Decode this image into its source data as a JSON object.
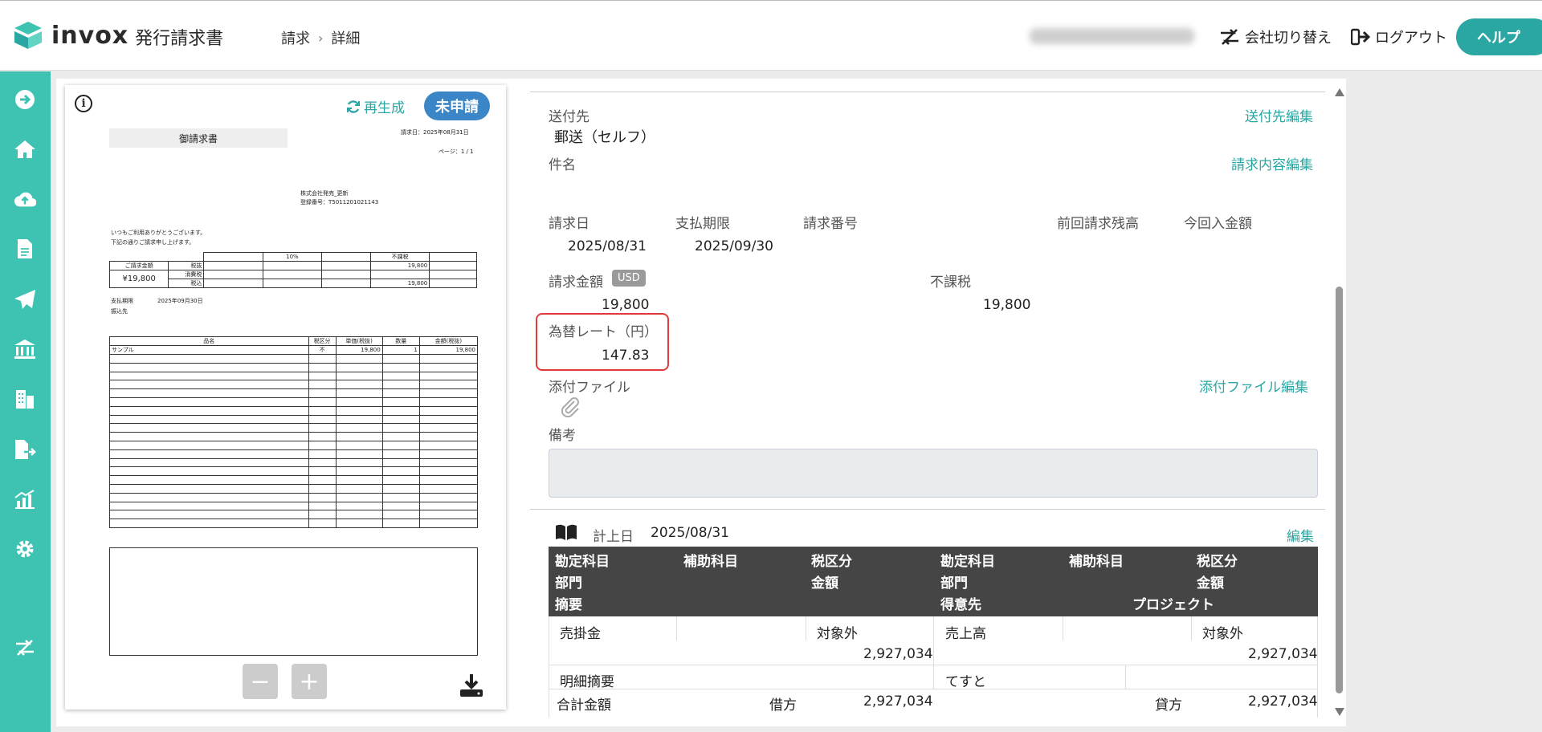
{
  "header": {
    "logo_word": "invox",
    "logo_sub": "発行請求書",
    "breadcrumb": [
      "請求",
      "詳細"
    ],
    "switch_company": "会社切り替え",
    "logout": "ログアウト",
    "help": "ヘルプ"
  },
  "sidebar": {
    "icons": [
      "arrow-right-icon",
      "home-icon",
      "cloud-upload-icon",
      "document-icon",
      "send-icon",
      "bank-icon",
      "building-icon",
      "file-export-icon",
      "chart-icon",
      "gear-icon",
      "switch-icon"
    ]
  },
  "preview": {
    "regen": "再生成",
    "status": "未申請",
    "doc": {
      "title": "御請求書",
      "date": "請求日：2025年08月31日",
      "page": "ページ：1 / 1",
      "company": "株式会社発売_更新",
      "reg_no": "登録番号：T5011201021143",
      "greeting1": "いつもご利用ありがとうございます。",
      "greeting2": "下記の通りご請求申し上げます。",
      "amount_label": "ご請求金額",
      "amount": "¥19,800",
      "rate10": "10%",
      "nontax": "不課税",
      "row_labels": [
        "税抜",
        "消費税",
        "税込"
      ],
      "nontax_vals": [
        "19,800",
        "",
        "19,800"
      ],
      "due_label": "支払期限",
      "due_date": "2025年09月30日",
      "bank_label": "振込先",
      "line_headers": [
        "品名",
        "税区分",
        "単価(税抜)",
        "数量",
        "金額(税抜)"
      ],
      "line_item": [
        "サンプル",
        "不",
        "19,800",
        "1",
        "19,800"
      ]
    }
  },
  "detail": {
    "send_to_label": "送付先",
    "send_to_value": "郵送（セルフ）",
    "send_to_edit": "送付先編集",
    "subject_label": "件名",
    "content_edit": "請求内容編集",
    "invoice_date_label": "請求日",
    "invoice_date": "2025/08/31",
    "due_label": "支払期限",
    "due_date": "2025/09/30",
    "number_label": "請求番号",
    "prev_balance_label": "前回請求残高",
    "received_label": "今回入金額",
    "amount_label": "請求金額",
    "currency": "USD",
    "amount": "19,800",
    "nontax_label": "不課税",
    "nontax": "19,800",
    "rate_label": "為替レート（円）",
    "rate": "147.83",
    "attach_label": "添付ファイル",
    "attach_edit": "添付ファイル編集",
    "memo_label": "備考",
    "posting_label": "計上日",
    "posting_date": "2025/08/31",
    "journal_edit": "編集"
  },
  "journal": {
    "header_row1": [
      "勘定科目",
      "補助科目",
      "税区分",
      "勘定科目",
      "補助科目",
      "税区分"
    ],
    "header_row2": [
      "部門",
      "金額",
      "部門",
      "金額"
    ],
    "header_row3": [
      "摘要",
      "得意先",
      "プロジェクト"
    ],
    "debit_account": "売掛金",
    "debit_tax": "対象外",
    "debit_amount": "2,927,034",
    "credit_account": "売上高",
    "credit_tax": "対象外",
    "credit_amount": "2,927,034",
    "line_memo_label": "明細摘要",
    "line_memo_value": "てすと",
    "total_label": "合計金額",
    "debit_label": "借方",
    "debit_total": "2,927,034",
    "credit_label": "貸方",
    "credit_total": "2,927,034"
  },
  "colors": {
    "accent": "#2aa6a3",
    "sidebar": "#3ec3b3",
    "badge": "#3b86c6",
    "highlight": "#e03a3a"
  }
}
